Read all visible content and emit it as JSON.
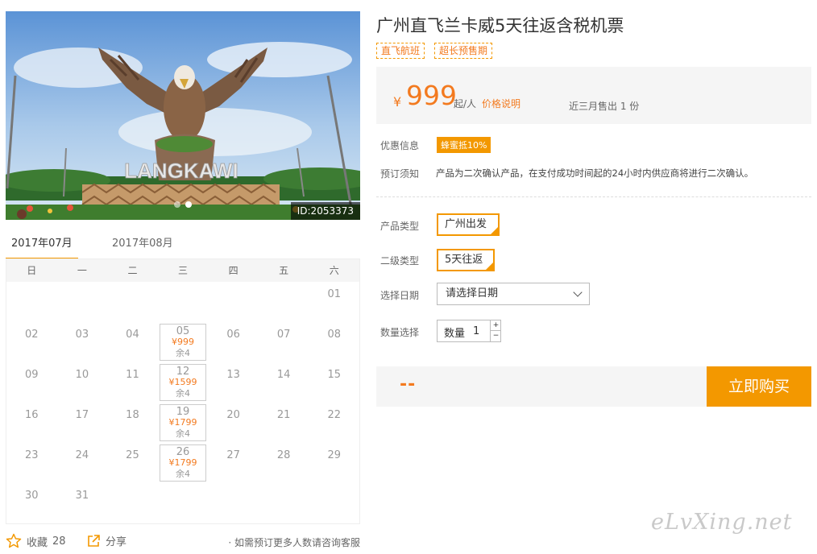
{
  "product": {
    "title": "广州直飞兰卡威5天往返含税机票",
    "tags": [
      "直飞航班",
      "超长预售期"
    ]
  },
  "hero": {
    "image_id": "ID:2053373",
    "sign_text": "LANGKAWI",
    "dot_count": 2,
    "active_dot": 1
  },
  "price": {
    "currency": "¥",
    "amount": "999",
    "unit": "起/人",
    "explain_link": "价格说明",
    "sold": "近三月售出 1 份"
  },
  "promo": {
    "label": "优惠信息",
    "badge": "蜂蜜抵10%"
  },
  "notice": {
    "label": "预订须知",
    "text": "产品为二次确认产品，在支付成功时间起的24小时内供应商将进行二次确认。"
  },
  "options": {
    "product_type_label": "产品类型",
    "product_type_value": "广州出发",
    "sub_type_label": "二级类型",
    "sub_type_value": "5天往返",
    "date_label": "选择日期",
    "date_placeholder": "请选择日期",
    "quantity_label": "数量选择",
    "quantity_prefix": "数量",
    "quantity_value": "1",
    "plus": "+",
    "minus": "−"
  },
  "buy": {
    "total": "--",
    "button": "立即购买"
  },
  "calendar": {
    "tabs": [
      "2017年07月",
      "2017年08月"
    ],
    "active_tab": 0,
    "weekdays": [
      "日",
      "一",
      "二",
      "三",
      "四",
      "五",
      "六"
    ],
    "weeks": [
      [
        null,
        null,
        null,
        null,
        null,
        null,
        {
          "day": "01"
        }
      ],
      [
        {
          "day": "02"
        },
        {
          "day": "03"
        },
        {
          "day": "04"
        },
        {
          "day": "05",
          "price": "¥999",
          "stock": "余4"
        },
        {
          "day": "06"
        },
        {
          "day": "07"
        },
        {
          "day": "08"
        }
      ],
      [
        {
          "day": "09"
        },
        {
          "day": "10"
        },
        {
          "day": "11"
        },
        {
          "day": "12",
          "price": "¥1599",
          "stock": "余4"
        },
        {
          "day": "13"
        },
        {
          "day": "14"
        },
        {
          "day": "15"
        }
      ],
      [
        {
          "day": "16"
        },
        {
          "day": "17"
        },
        {
          "day": "18"
        },
        {
          "day": "19",
          "price": "¥1799",
          "stock": "余4"
        },
        {
          "day": "20"
        },
        {
          "day": "21"
        },
        {
          "day": "22"
        }
      ],
      [
        {
          "day": "23"
        },
        {
          "day": "24"
        },
        {
          "day": "25"
        },
        {
          "day": "26",
          "price": "¥1799",
          "stock": "余4"
        },
        {
          "day": "27"
        },
        {
          "day": "28"
        },
        {
          "day": "29"
        }
      ],
      [
        {
          "day": "30"
        },
        {
          "day": "31"
        },
        null,
        null,
        null,
        null,
        null
      ]
    ]
  },
  "footer": {
    "favorite_label": "收藏",
    "favorite_count": "28",
    "share_label": "分享",
    "note": "· 如需预订更多人数请咨询客服"
  },
  "watermark": "eLvXing.net",
  "colors": {
    "accent": "#f39800",
    "price": "#f37a1f",
    "panel": "#f5f5f5"
  }
}
